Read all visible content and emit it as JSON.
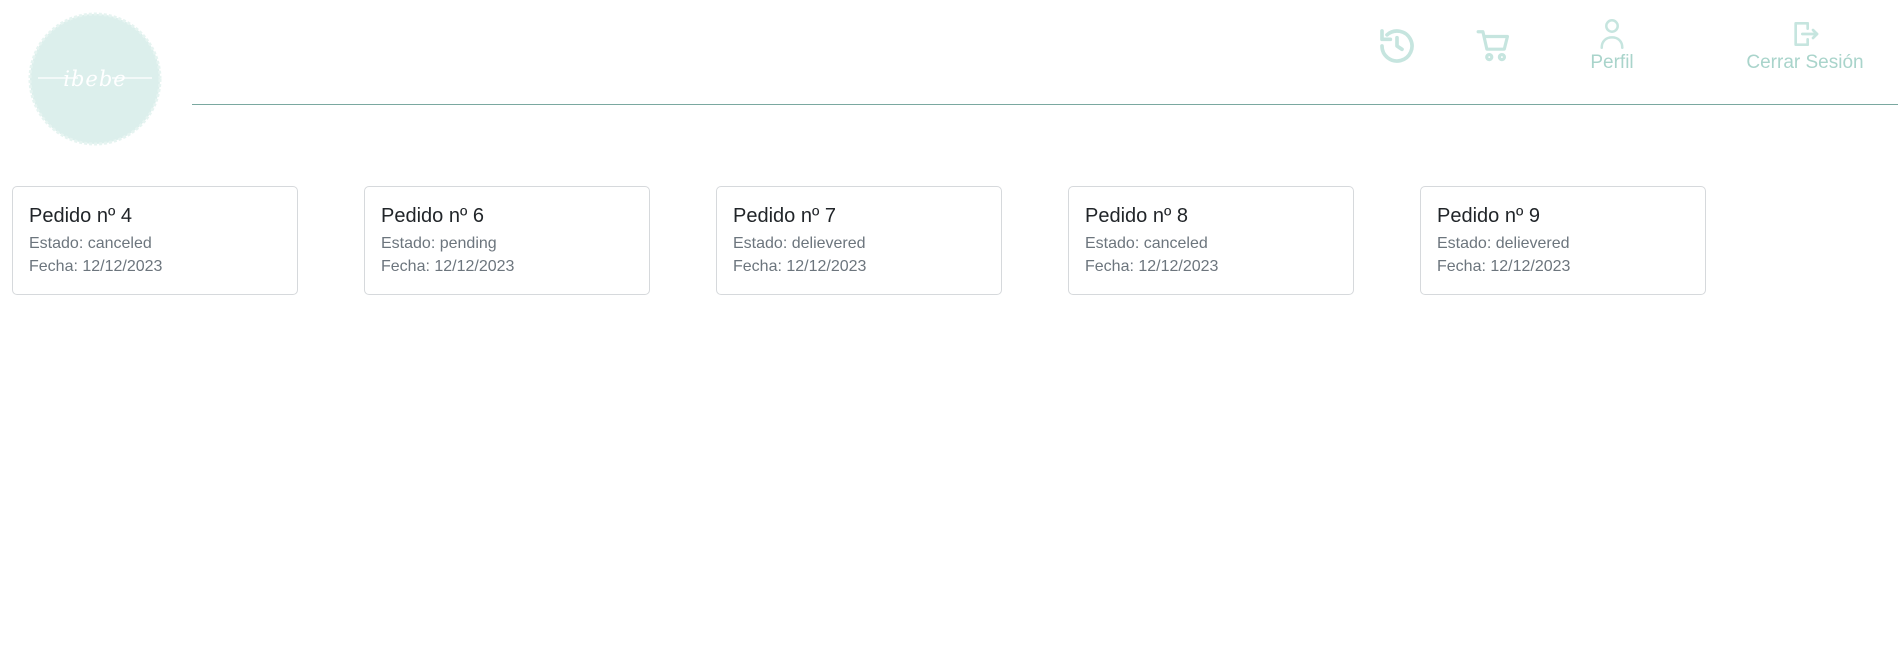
{
  "brand": {
    "logo_text": "ibebe",
    "logo_color": "#dcefec"
  },
  "nav": {
    "history_icon": "history-icon",
    "cart_icon": "cart-icon",
    "profile_label": "Perfil",
    "profile_icon": "user-icon",
    "logout_label": "Cerrar Sesión",
    "logout_icon": "logout-icon",
    "icon_color": "#c6e5df"
  },
  "orders": [
    {
      "title": "Pedido nº 4",
      "estado_label": "Estado:",
      "estado": "canceled",
      "fecha_label": "Fecha:",
      "fecha": "12/12/2023"
    },
    {
      "title": "Pedido nº 6",
      "estado_label": "Estado:",
      "estado": "pending",
      "fecha_label": "Fecha:",
      "fecha": "12/12/2023"
    },
    {
      "title": "Pedido nº 7",
      "estado_label": "Estado:",
      "estado": "delievered",
      "fecha_label": "Fecha:",
      "fecha": "12/12/2023"
    },
    {
      "title": "Pedido nº 8",
      "estado_label": "Estado:",
      "estado": "canceled",
      "fecha_label": "Fecha:",
      "fecha": "12/12/2023"
    },
    {
      "title": "Pedido nº 9",
      "estado_label": "Estado:",
      "estado": "delievered",
      "fecha_label": "Fecha:",
      "fecha": "12/12/2023"
    }
  ]
}
